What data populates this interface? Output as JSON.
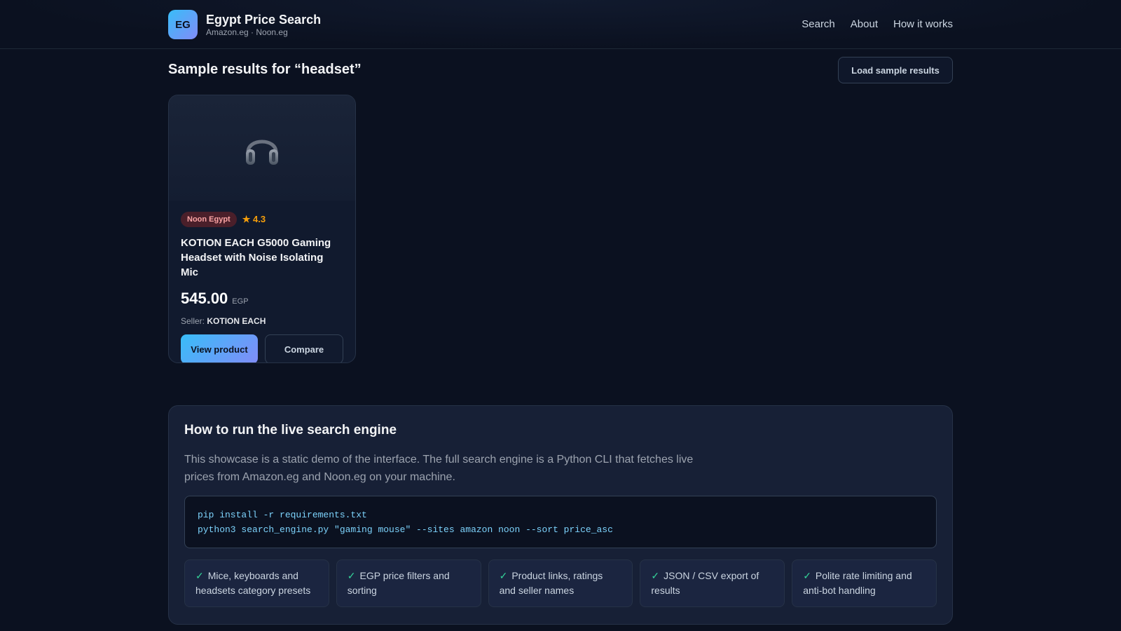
{
  "brand": {
    "logo_text": "EG",
    "title": "Egypt Price Search",
    "subtitle": "Amazon.eg · Noon.eg"
  },
  "nav": {
    "items": [
      "Search",
      "About",
      "How it works"
    ]
  },
  "results": {
    "title": "Sample results for “headset”",
    "load_button": "Load sample results"
  },
  "card": {
    "icon": "headphones-icon",
    "source": "Noon Egypt",
    "rating": "★ 4.3",
    "title": "KOTION EACH G5000 Gaming Headset with Noise Isolating Mic",
    "price": "545.00",
    "currency": "EGP",
    "seller_label": "Seller:",
    "seller_name": "KOTION EACH",
    "view_button": "View product",
    "compare_button": "Compare"
  },
  "howto": {
    "title": "How to run the live search engine",
    "description": "This showcase is a static demo of the interface. The full search engine is a Python CLI that fetches live prices from Amazon.eg and Noon.eg on your machine.",
    "code_lines": [
      "pip install -r requirements.txt",
      "python3 search_engine.py \"gaming mouse\" --sites amazon noon --sort price_asc"
    ],
    "features": [
      "Mice, keyboards and headsets category presets",
      "EGP price filters and sorting",
      "Product links, ratings and seller names",
      "JSON / CSV export of results",
      "Polite rate limiting and anti-bot handling"
    ],
    "check_glyph": "✓"
  },
  "colors": {
    "background": "#0b1120",
    "accent_start": "#38bdf8",
    "accent_end": "#818cf8",
    "rating": "#f59e0b",
    "badge_bg": "#4a1f2a",
    "check": "#34d399"
  }
}
